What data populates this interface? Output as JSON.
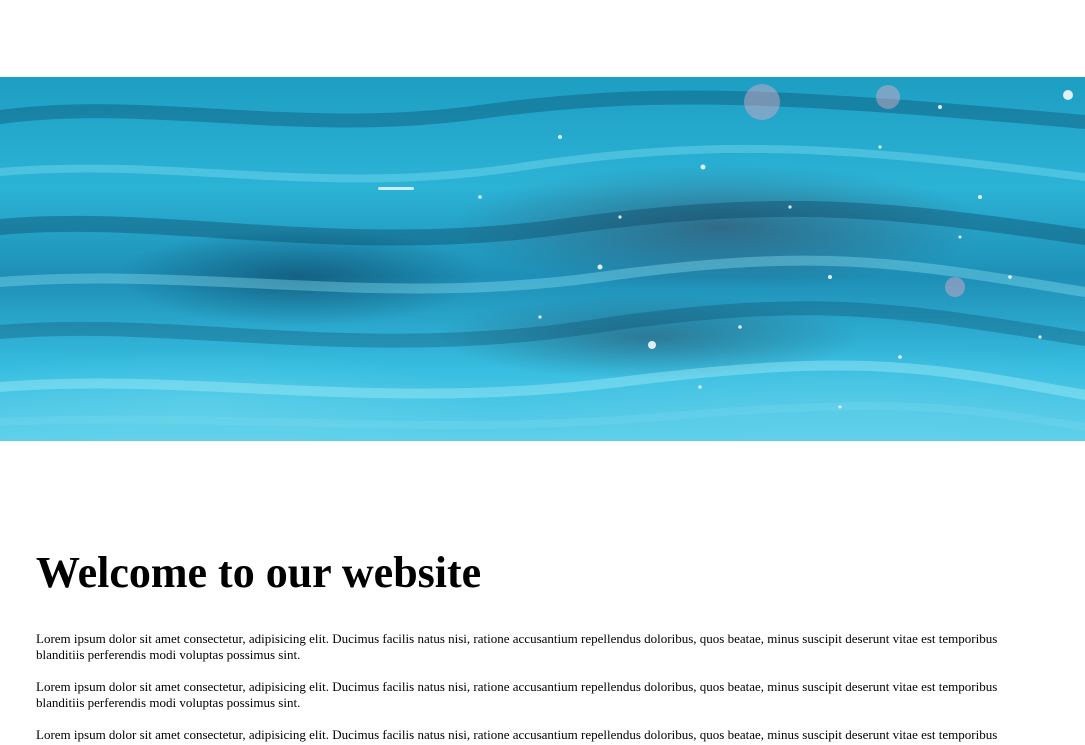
{
  "hero": {
    "image_name": "ocean-water-image",
    "colors": [
      "#1d9ec2",
      "#2bb3d6",
      "#5fd0ea"
    ]
  },
  "main": {
    "heading": "Welcome to our website",
    "paragraphs": [
      "Lorem ipsum dolor sit amet consectetur, adipisicing elit. Ducimus facilis natus nisi, ratione accusantium repellendus doloribus, quos beatae, minus suscipit deserunt vitae est temporibus blanditiis perferendis modi voluptas possimus sint.",
      "Lorem ipsum dolor sit amet consectetur, adipisicing elit. Ducimus facilis natus nisi, ratione accusantium repellendus doloribus, quos beatae, minus suscipit deserunt vitae est temporibus blanditiis perferendis modi voluptas possimus sint.",
      "Lorem ipsum dolor sit amet consectetur, adipisicing elit. Ducimus facilis natus nisi, ratione accusantium repellendus doloribus, quos beatae, minus suscipit deserunt vitae est temporibus blanditiis perferendis modi voluptas possimus sint."
    ]
  }
}
